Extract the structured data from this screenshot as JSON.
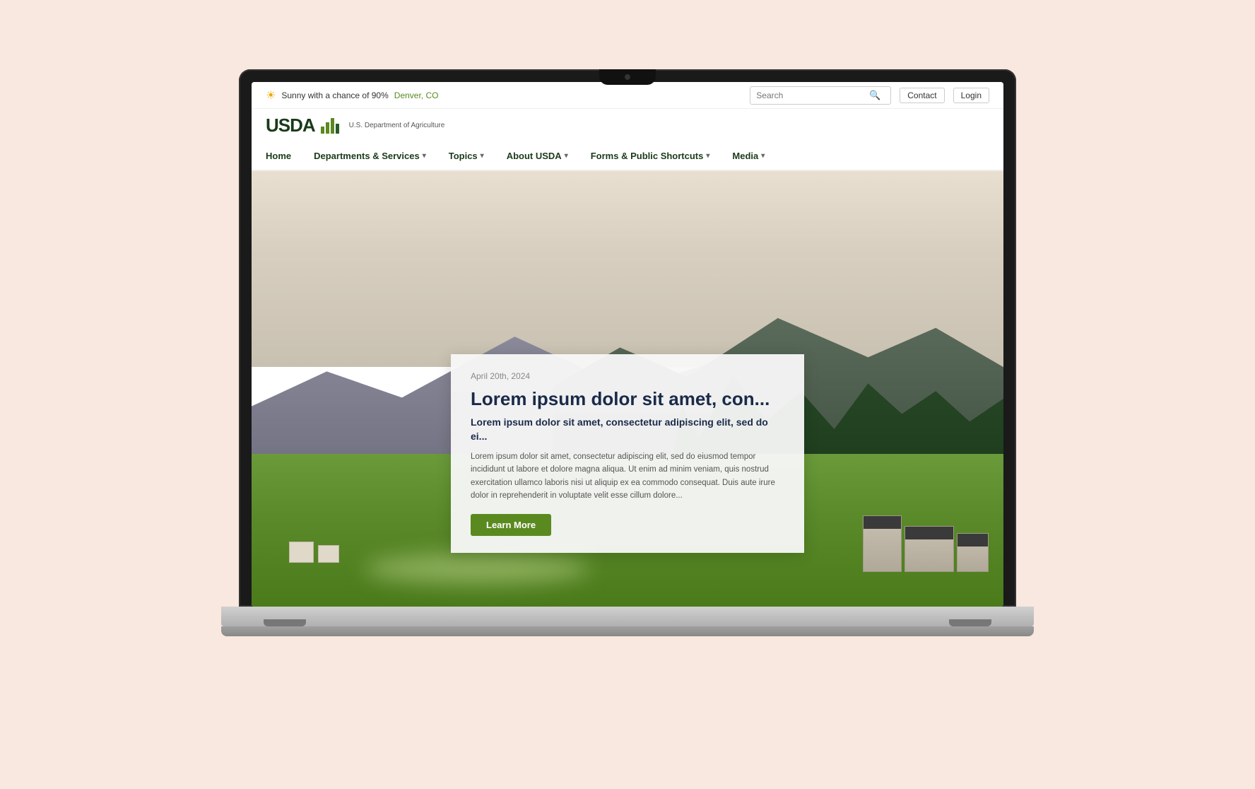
{
  "body_bg": "#f9e8df",
  "weather": {
    "icon": "☀",
    "text": "Sunny with a chance of 90%",
    "location": "Denver, CO"
  },
  "search": {
    "placeholder": "Search"
  },
  "utility": {
    "contact_label": "Contact",
    "login_label": "Login"
  },
  "logo": {
    "usda_text": "USDA",
    "agency_name": "U.S. Department of Agriculture"
  },
  "nav": {
    "items": [
      {
        "label": "Home",
        "has_dropdown": false
      },
      {
        "label": "Departments & Services",
        "has_dropdown": true
      },
      {
        "label": "Topics",
        "has_dropdown": true
      },
      {
        "label": "About USDA",
        "has_dropdown": true
      },
      {
        "label": "Forms & Public Shortcuts",
        "has_dropdown": true
      },
      {
        "label": "Media",
        "has_dropdown": true
      }
    ]
  },
  "hero_card": {
    "date": "April 20th, 2024",
    "title": "Lorem ipsum dolor sit amet, con...",
    "subtitle": "Lorem ipsum dolor sit amet, consectetur adipiscing elit, sed do ei...",
    "body": "Lorem ipsum dolor sit amet, consectetur adipiscing elit, sed do eiusmod tempor incididunt ut labore et dolore magna aliqua. Ut enim ad minim veniam, quis nostrud exercitation ullamco laboris nisi ut aliquip ex ea commodo consequat. Duis aute irure dolor in reprehenderit in voluptate velit esse cillum dolore...",
    "learn_more_label": "Learn More"
  }
}
